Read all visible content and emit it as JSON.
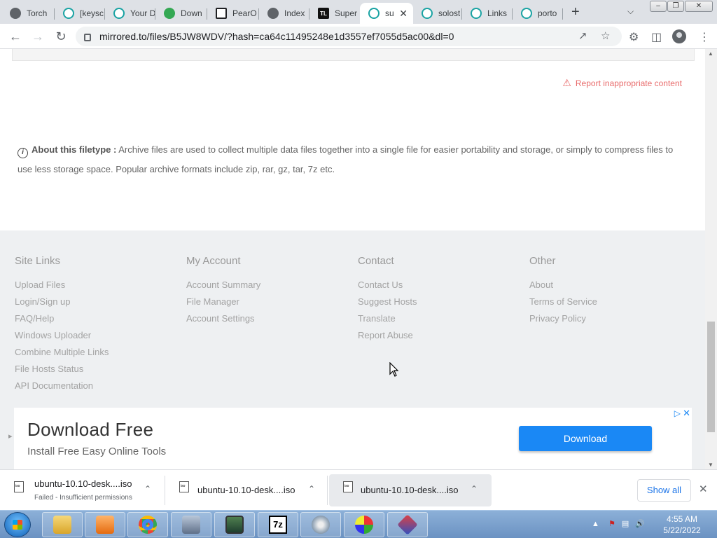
{
  "window": {
    "minimize": "‒",
    "restore": "❐",
    "close": "✕"
  },
  "tabs": [
    {
      "title": "Torch",
      "icon": "globe-icon"
    },
    {
      "title": "[keysc",
      "icon": "teal-gear-icon"
    },
    {
      "title": "Your D",
      "icon": "teal-gear-icon"
    },
    {
      "title": "Down",
      "icon": "drive-icon"
    },
    {
      "title": "PearO",
      "icon": "bank-icon"
    },
    {
      "title": "Index",
      "icon": "globe-icon"
    },
    {
      "title": "Super",
      "icon": "tl-icon"
    },
    {
      "title": "su",
      "icon": "teal-gear-icon",
      "active": true
    },
    {
      "title": "solost",
      "icon": "teal-gear-icon"
    },
    {
      "title": "Links",
      "icon": "teal-gear-icon"
    },
    {
      "title": "porto",
      "icon": "teal-gear-icon"
    }
  ],
  "toolbar": {
    "url": "mirrored.to/files/B5JW8WDV/?hash=ca64c11495248e1d3557ef7055d5ac00&dl=0"
  },
  "page": {
    "report_link": "Report inappropriate content",
    "about_label": "About this filetype :",
    "about_text": "Archive files are used to collect multiple data files together into a single file for easier portability and storage, or simply to compress files to use less storage space. Popular archive formats include zip, rar, gz, tar, 7z etc.",
    "footer": {
      "site_links": {
        "heading": "Site Links",
        "items": [
          "Upload Files",
          "Login/Sign up",
          "FAQ/Help",
          "Windows Uploader",
          "Combine Multiple Links",
          "File Hosts Status",
          "API Documentation"
        ]
      },
      "my_account": {
        "heading": "My Account",
        "items": [
          "Account Summary",
          "File Manager",
          "Account Settings"
        ]
      },
      "contact": {
        "heading": "Contact",
        "items": [
          "Contact Us",
          "Suggest Hosts",
          "Translate",
          "Report Abuse"
        ]
      },
      "other": {
        "heading": "Other",
        "items": [
          "About",
          "Terms of Service",
          "Privacy Policy"
        ]
      }
    },
    "ad": {
      "headline": "Download Free",
      "subline": "Install Free Easy Online Tools",
      "button": "Download"
    }
  },
  "downloads": {
    "items": [
      {
        "name": "ubuntu-10.10-desk....iso",
        "status": "Failed - Insufficient permissions"
      },
      {
        "name": "ubuntu-10.10-desk....iso",
        "status": ""
      },
      {
        "name": "ubuntu-10.10-desk....iso",
        "status": ""
      }
    ],
    "show_all": "Show all"
  },
  "taskbar": {
    "time": "4:55 AM",
    "date": "5/22/2022"
  },
  "colors": {
    "link_red": "#e86b6b",
    "ad_button": "#1a88f5",
    "footer_bg": "#eef0f2"
  }
}
